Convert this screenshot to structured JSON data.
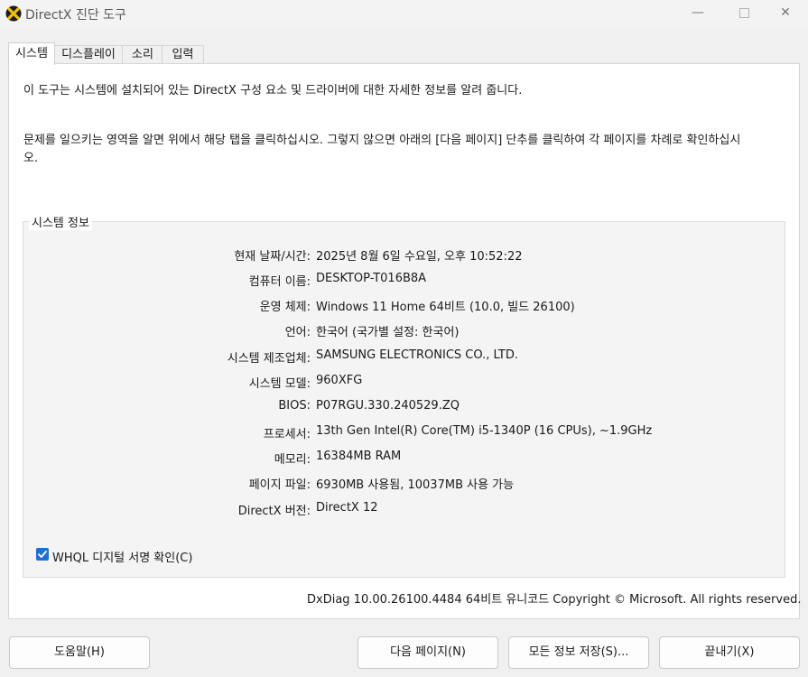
{
  "window": {
    "title": "DirectX 진단 도구",
    "minimize_glyph": "—",
    "close_glyph": "✕"
  },
  "tabs": [
    {
      "label": "시스템",
      "active": true
    },
    {
      "label": "디스플레이",
      "active": false
    },
    {
      "label": "소리",
      "active": false
    },
    {
      "label": "입력",
      "active": false
    }
  ],
  "intro": {
    "line1": "이 도구는 시스템에 설치되어 있는 DirectX 구성 요소 및 드라이버에 대한 자세한 정보를 알려 줍니다.",
    "line2": "문제를 일으키는 영역을 알면 위에서 해당 탭을 클릭하십시오. 그렇지 않으면 아래의 [다음 페이지] 단추를 클릭하여 각 페이지를 차례로 확인하십시오."
  },
  "system_info": {
    "group_title": "시스템 정보",
    "rows": [
      {
        "label": "현재 날짜/시간:",
        "value": "2025년 8월 6일 수요일, 오후 10:52:22"
      },
      {
        "label": "컴퓨터 이름:",
        "value": "DESKTOP-T016B8A"
      },
      {
        "label": "운영 체제:",
        "value": "Windows 11 Home 64비트 (10.0, 빌드 26100)"
      },
      {
        "label": "언어:",
        "value": "한국어 (국가별 설정: 한국어)"
      },
      {
        "label": "시스템 제조업체:",
        "value": "SAMSUNG ELECTRONICS CO., LTD."
      },
      {
        "label": "시스템 모델:",
        "value": "960XFG"
      },
      {
        "label": "BIOS:",
        "value": "P07RGU.330.240529.ZQ"
      },
      {
        "label": "프로세서:",
        "value": "13th Gen Intel(R) Core(TM) i5-1340P (16 CPUs), ~1.9GHz"
      },
      {
        "label": "메모리:",
        "value": "16384MB RAM"
      },
      {
        "label": "페이지 파일:",
        "value": "6930MB 사용됨, 10037MB 사용 가능"
      },
      {
        "label": "DirectX 버전:",
        "value": "DirectX 12"
      }
    ]
  },
  "whql": {
    "label": "WHQL 디지털 서명 확인(C)",
    "checked": true
  },
  "footer": "DxDiag 10.00.26100.4484 64비트 유니코드  Copyright © Microsoft. All rights reserved.",
  "buttons": {
    "help": "도움말(H)",
    "next": "다음 페이지(N)",
    "save": "모든 정보 저장(S)...",
    "exit": "끝내기(X)"
  },
  "colors": {
    "accent": "#1e6fd0",
    "panel": "#ffffff",
    "background": "#f0f0f0"
  }
}
